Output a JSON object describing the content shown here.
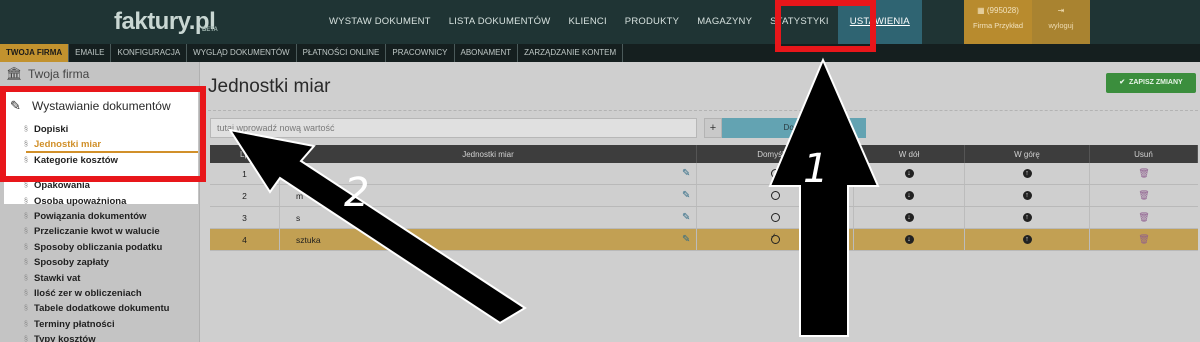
{
  "header": {
    "logo": "faktury.pl",
    "logo_badge": "BETA",
    "nav": [
      "WYSTAW DOKUMENT",
      "LISTA DOKUMENTÓW",
      "KLIENCI",
      "PRODUKTY",
      "MAGAZYNY",
      "STATYSTYKI",
      "USTAWIENIA"
    ],
    "firm_id": "(995028)",
    "firm_name": "Firma Przykład",
    "logout": "wyloguj"
  },
  "subnav": [
    "TWOJA FIRMA",
    "EMAILE",
    "KONFIGURACJA",
    "WYGLĄD DOKUMENTÓW",
    "PŁATNOŚCI ONLINE",
    "PRACOWNICY",
    "ABONAMENT",
    "ZARZĄDZANIE KONTEM"
  ],
  "sidebar": {
    "section1": "Twoja firma",
    "section2": "Wystawianie dokumentów",
    "items": [
      "Dopiski",
      "Jednostki miar",
      "Kategorie kosztów",
      "Opakowania",
      "Osoba upoważniona",
      "Powiązania dokumentów",
      "Przeliczanie kwot w walucie",
      "Sposoby obliczania podatku",
      "Sposoby zapłaty",
      "Stawki vat",
      "Ilość zer w obliczeniach",
      "Tabele dodatkowe dokumentu",
      "Terminy płatności",
      "Typy kosztów"
    ]
  },
  "main": {
    "title": "Jednostki miar",
    "save_label": "ZAPISZ ZMIANY",
    "input_placeholder": "tutaj wprowadź nową wartość",
    "add_label": "Dodaj",
    "columns": [
      "Lp",
      "Jednostki miar",
      "Domyślna",
      "W dół",
      "W górę",
      "Usuń"
    ],
    "rows": [
      {
        "lp": "1",
        "name": "",
        "default": false
      },
      {
        "lp": "2",
        "name": "m",
        "default": false
      },
      {
        "lp": "3",
        "name": "s",
        "default": false
      },
      {
        "lp": "4",
        "name": "sztuka",
        "default": true
      }
    ]
  },
  "annotations": {
    "label1": "1",
    "label2": "2",
    "color": "#e8161a"
  }
}
